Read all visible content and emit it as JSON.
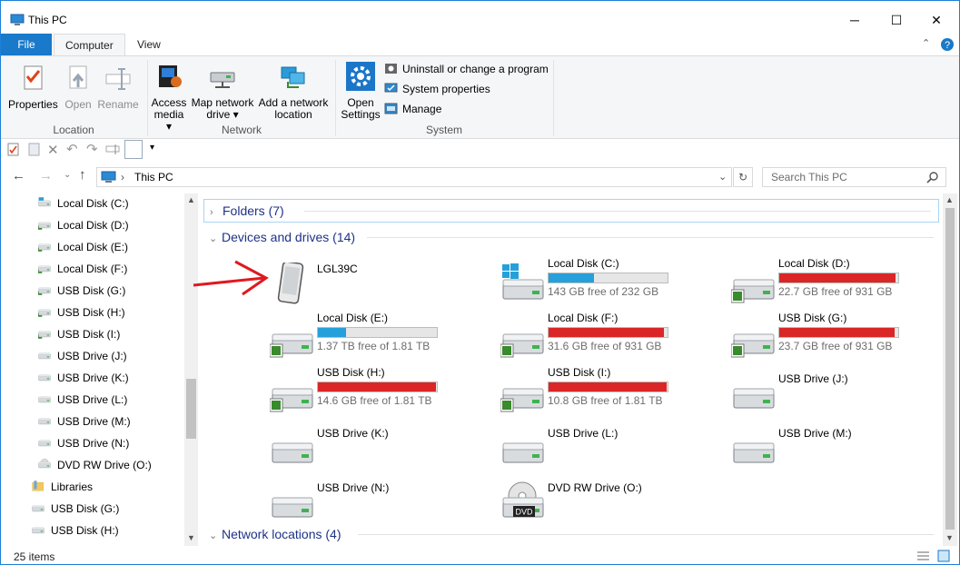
{
  "window": {
    "title": "This PC",
    "minimize": "─",
    "maximize": "☐",
    "close": "✕"
  },
  "tabs": {
    "file": "File",
    "computer": "Computer",
    "view": "View"
  },
  "ribbon": {
    "location": {
      "label": "Location",
      "properties": "Properties",
      "open": "Open",
      "rename": "Rename"
    },
    "network": {
      "label": "Network",
      "access_media_1": "Access",
      "access_media_2": "media ▾",
      "map_drive_1": "Map network",
      "map_drive_2": "drive ▾",
      "add_location_1": "Add a network",
      "add_location_2": "location"
    },
    "system": {
      "label": "System",
      "open_settings_1": "Open",
      "open_settings_2": "Settings",
      "uninstall": "Uninstall or change a program",
      "system_properties": "System properties",
      "manage": "Manage"
    }
  },
  "address": {
    "path": "This PC",
    "search_placeholder": "Search This PC"
  },
  "nav": {
    "items": [
      {
        "label": "Local Disk (C:)",
        "icon": "windows-drive-icon"
      },
      {
        "label": "Local Disk  (D:)",
        "icon": "drive-icon"
      },
      {
        "label": "Local Disk  (E:)",
        "icon": "drive-icon"
      },
      {
        "label": "Local Disk  (F:)",
        "icon": "drive-icon"
      },
      {
        "label": "USB Disk (G:)",
        "icon": "drive-icon"
      },
      {
        "label": "USB Disk (H:)",
        "icon": "drive-icon"
      },
      {
        "label": "USB Disk (I:)",
        "icon": "drive-icon"
      },
      {
        "label": "USB Drive (J:)",
        "icon": "usb-drive-icon"
      },
      {
        "label": "USB Drive (K:)",
        "icon": "usb-drive-icon"
      },
      {
        "label": "USB Drive (L:)",
        "icon": "usb-drive-icon"
      },
      {
        "label": "USB Drive (M:)",
        "icon": "usb-drive-icon"
      },
      {
        "label": "USB Drive (N:)",
        "icon": "usb-drive-icon"
      },
      {
        "label": "DVD RW Drive (O:)",
        "icon": "dvd-drive-icon"
      },
      {
        "label": "Libraries",
        "icon": "libraries-icon"
      },
      {
        "label": "USB Disk (G:)",
        "icon": "usb-drive-icon"
      },
      {
        "label": "USB Disk (H:)",
        "icon": "usb-drive-icon"
      }
    ]
  },
  "groups": {
    "folders": "Folders (7)",
    "devices": "Devices and drives (14)",
    "network": "Network locations (4)"
  },
  "devices": [
    {
      "name": "LGL39C",
      "type": "phone"
    },
    {
      "name": "Local Disk (C:)",
      "type": "windows-drive",
      "free": "143 GB free of 232 GB",
      "used": 0.38,
      "color": "#26a0da"
    },
    {
      "name": "Local Disk  (D:)",
      "type": "drive",
      "free": "22.7 GB free of 931 GB",
      "used": 0.98,
      "color": "#da2626"
    },
    {
      "name": "Local Disk  (E:)",
      "type": "drive",
      "free": "1.37 TB free of 1.81 TB",
      "used": 0.24,
      "color": "#26a0da"
    },
    {
      "name": "Local Disk  (F:)",
      "type": "drive",
      "free": "31.6 GB free of 931 GB",
      "used": 0.97,
      "color": "#da2626"
    },
    {
      "name": "USB Disk (G:)",
      "type": "drive",
      "free": "23.7 GB free of 931 GB",
      "used": 0.97,
      "color": "#da2626"
    },
    {
      "name": "USB Disk (H:)",
      "type": "drive",
      "free": "14.6 GB free of 1.81 TB",
      "used": 0.99,
      "color": "#da2626"
    },
    {
      "name": "USB Disk (I:)",
      "type": "drive",
      "free": "10.8 GB free of 1.81 TB",
      "used": 0.99,
      "color": "#da2626"
    },
    {
      "name": "USB Drive (J:)",
      "type": "usb"
    },
    {
      "name": "USB Drive (K:)",
      "type": "usb"
    },
    {
      "name": "USB Drive (L:)",
      "type": "usb"
    },
    {
      "name": "USB Drive (M:)",
      "type": "usb"
    },
    {
      "name": "USB Drive (N:)",
      "type": "usb"
    },
    {
      "name": "DVD RW Drive (O:)",
      "type": "dvd",
      "badge": "DVD"
    }
  ],
  "status": {
    "items": "25 items"
  },
  "colors": {
    "accent": "#1979ca",
    "full_bar": "#da2626",
    "ok_bar": "#26a0da",
    "group_text": "#1e3287",
    "annotation_arrow": "#e0191f"
  }
}
